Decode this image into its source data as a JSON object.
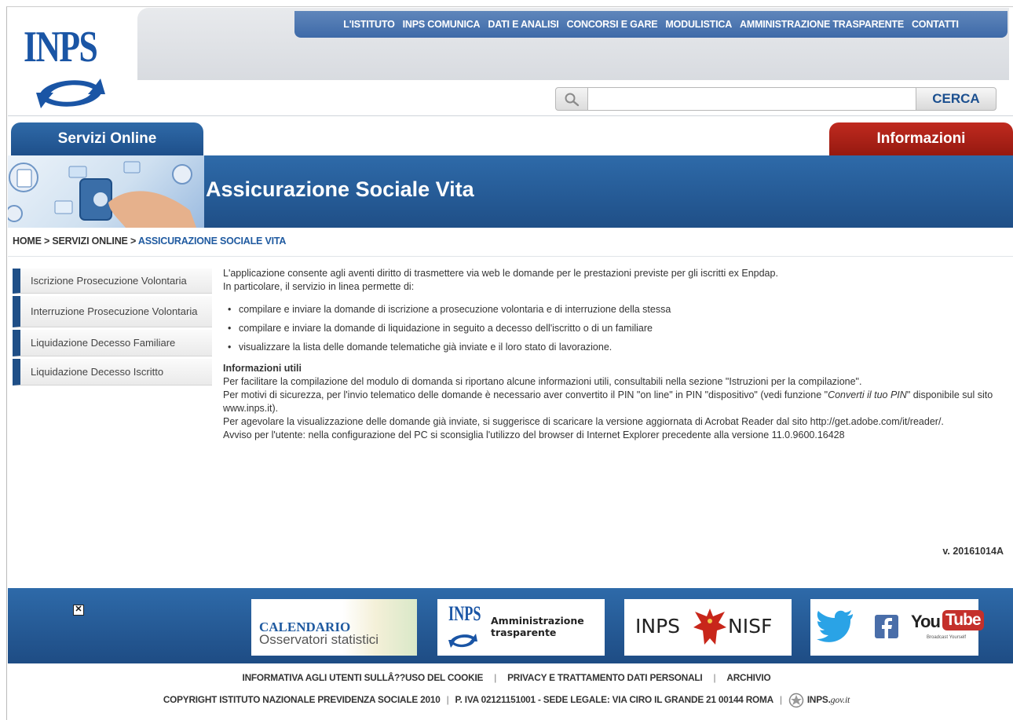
{
  "logo": {
    "text": "INPS"
  },
  "top_nav": [
    "L'ISTITUTO",
    "INPS COMUNICA",
    "DATI E ANALISI",
    "CONCORSI E GARE",
    "MODULISTICA",
    "AMMINISTRAZIONE TRASPARENTE",
    "CONTATTI"
  ],
  "search": {
    "value": "",
    "button": "CERCA"
  },
  "tabs": {
    "servizi": "Servizi Online",
    "informazioni": "Informazioni"
  },
  "banner": {
    "title": "Assicurazione Sociale Vita"
  },
  "breadcrumb": {
    "home": "HOME",
    "sep": ">",
    "servizi": "SERVIZI ONLINE",
    "current": "ASSICURAZIONE SOCIALE VITA"
  },
  "sidebar": [
    {
      "label": "Iscrizione Prosecuzione Volontaria"
    },
    {
      "label": "Interruzione Prosecuzione Volontaria"
    },
    {
      "label": "Liquidazione Decesso Familiare"
    },
    {
      "label": "Liquidazione Decesso Iscritto"
    }
  ],
  "content": {
    "intro1": "L'applicazione consente agli aventi diritto di trasmettere via web le domande per le prestazioni previste per gli iscritti ex Enpdap.",
    "intro2": "In particolare, il servizio in linea permette di:",
    "bullets": [
      "compilare e inviare la domande di iscrizione a prosecuzione volontaria e di interruzione della stessa",
      "compilare e inviare la domande di liquidazione in seguito a decesso dell'iscritto o di un familiare",
      "visualizzare la lista delle domande telematiche già inviate e il loro stato di lavorazione."
    ],
    "info_heading": "Informazioni utili",
    "info_text": "Per facilitare la compilazione del modulo di domanda si riportano alcune informazioni utili, consultabili nella sezione \"Istruzioni per la compilazione\".",
    "security_a": "Per motivi di sicurezza, per l'invio telematico delle domande è necessario aver convertito il PIN \"on line\" in PIN \"dispositivo\" (vedi funzione \"",
    "security_em": "Converti il tuo PIN",
    "security_b": "\" disponibile sul sito www.inps.it).",
    "acrobat": "Per agevolare la visualizzazione delle domande già inviate, si suggerisce di scaricare la versione aggiornata di Acrobat Reader dal sito http://get.adobe.com/it/reader/.",
    "avviso": "Avviso per l'utente: nella configurazione del PC si sconsiglia l'utilizzo del browser di Internet Explorer precedente alla versione 11.0.9600.16428",
    "version": "v. 20161014A"
  },
  "footer": {
    "calendario_1": "CALENDARIO",
    "calendario_2": "Osservatori statistici",
    "amm_logo": "INPS",
    "amm_1": "Amministrazione",
    "amm_2": "trasparente",
    "nisf_a": "INPS",
    "nisf_b": "NISF",
    "youtube_a": "You",
    "youtube_b": "Tube",
    "youtube_c": "Broadcast Yourself",
    "links": [
      "INFORMATIVA AGLI UTENTI SULLÂ??USO DEL COOKIE",
      "PRIVACY E TRATTAMENTO DATI PERSONALI",
      "ARCHIVIO"
    ],
    "copyright": "COPYRIGHT ISTITUTO NAZIONALE PREVIDENZA SOCIALE 2010",
    "piva": "P. IVA 02121151001 - SEDE LEGALE: VIA CIRO IL GRANDE 21 00144 ROMA",
    "gov_a": "INPS.",
    "gov_b": "gov.it"
  },
  "colors": {
    "brand_blue": "#1f4f87",
    "info_red": "#b3261a",
    "link_blue": "#1f5aa0"
  }
}
